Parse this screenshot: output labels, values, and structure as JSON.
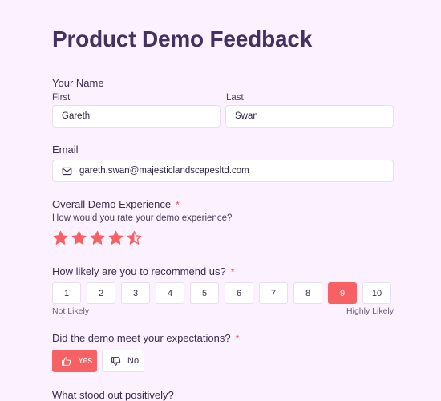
{
  "form": {
    "title": "Product Demo Feedback"
  },
  "name": {
    "label": "Your Name",
    "first_label": "First",
    "first_value": "Gareth",
    "last_label": "Last",
    "last_value": "Swan"
  },
  "email": {
    "label": "Email",
    "value": "gareth.swan@majesticlandscapesltd.com",
    "icon": "mail-icon"
  },
  "experience": {
    "label": "Overall Demo Experience",
    "required_mark": "*",
    "question": "How would you rate your demo experience?",
    "rating": 4.5,
    "max": 5,
    "star_color": "#f76164"
  },
  "recommend": {
    "label": "How likely are you to recommend us?",
    "required_mark": "*",
    "options": [
      "1",
      "2",
      "3",
      "4",
      "5",
      "6",
      "7",
      "8",
      "9",
      "10"
    ],
    "selected": "9",
    "low_label": "Not Likely",
    "high_label": "Highly Likely"
  },
  "expectations": {
    "label": "Did the demo meet your expectations?",
    "required_mark": "*",
    "yes_label": "Yes",
    "no_label": "No",
    "selected": "Yes"
  },
  "positives": {
    "label": "What stood out positively?"
  },
  "colors": {
    "accent": "#f76164",
    "title": "#43315f",
    "background": "#fbf1ff"
  }
}
